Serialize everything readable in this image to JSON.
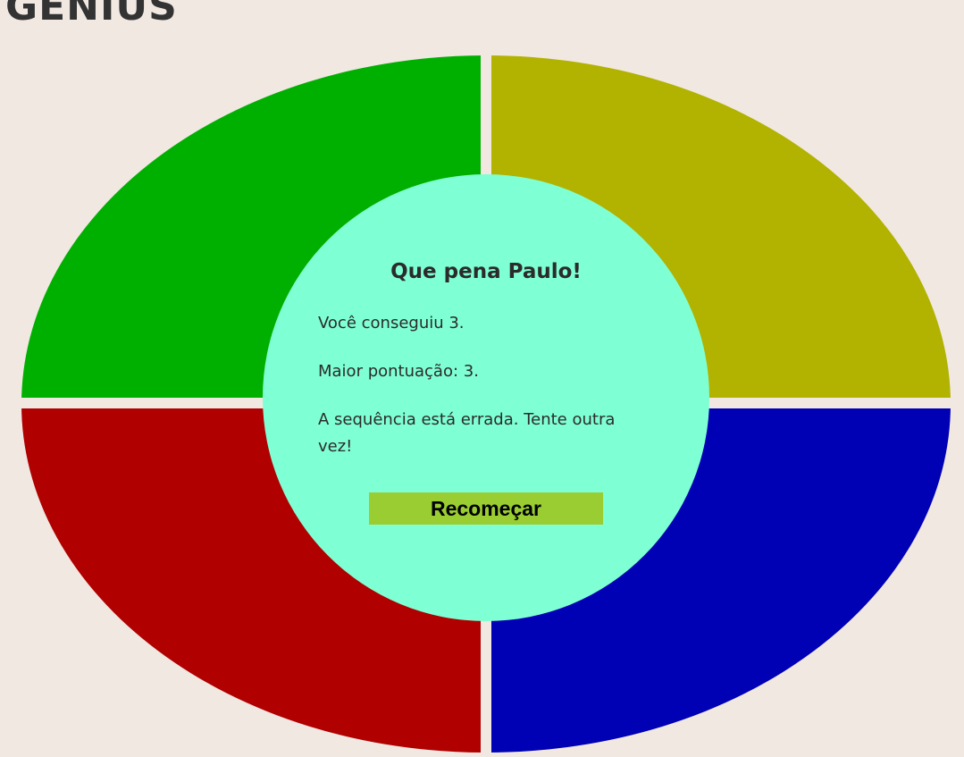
{
  "app": {
    "title": "GENIUS"
  },
  "board": {
    "colors": {
      "green": "#00b000",
      "yellow": "#b2b200",
      "red": "#b00000",
      "blue": "#0000b4",
      "center": "#7fffd4",
      "background": "#f1e8e2"
    }
  },
  "message": {
    "title": "Que pena Paulo!",
    "score_text": "Você conseguiu 3.",
    "high_score_text": "Maior pontuação: 3.",
    "error_text": "A sequência está errada. Tente outra vez!",
    "restart_label": "Recomeçar",
    "restart_color": "#9acd32"
  }
}
